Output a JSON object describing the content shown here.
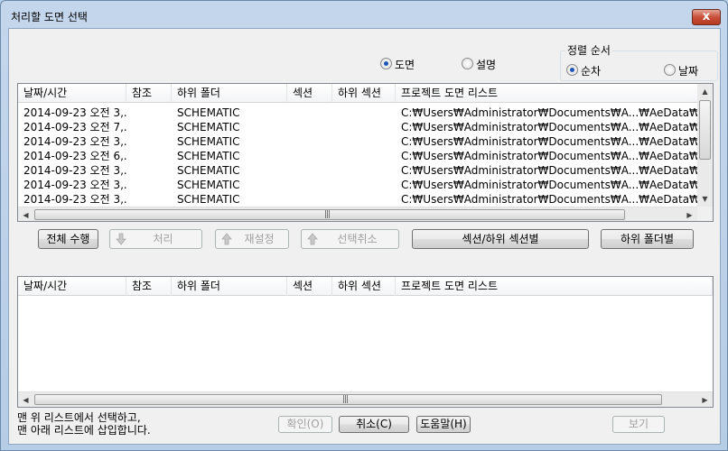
{
  "window": {
    "title": "처리할 도면 선택",
    "close_label": "x"
  },
  "view_mode": {
    "options": [
      {
        "label": "도면",
        "checked": true
      },
      {
        "label": "설명",
        "checked": false
      }
    ]
  },
  "sort": {
    "group_label": "정렬 순서",
    "options": [
      {
        "label": "순차",
        "checked": true
      },
      {
        "label": "날짜",
        "checked": false
      }
    ]
  },
  "columns": [
    "날짜/시간",
    "참조",
    "하위 폴더",
    "섹션",
    "하위 섹션",
    "프로젝트 도면 리스트"
  ],
  "upper_list": {
    "rows": [
      {
        "datetime": "2014-09-23 오전 3,...",
        "ref": "",
        "subfolder": "SCHEMATIC",
        "section": "",
        "subsection": "",
        "path": "C:₩Users₩Administrator₩Documents₩A...₩AeData₩pro"
      },
      {
        "datetime": "2014-09-23 오전 7,...",
        "ref": "",
        "subfolder": "SCHEMATIC",
        "section": "",
        "subsection": "",
        "path": "C:₩Users₩Administrator₩Documents₩A...₩AeData₩pro"
      },
      {
        "datetime": "2014-09-23 오전 3,...",
        "ref": "",
        "subfolder": "SCHEMATIC",
        "section": "",
        "subsection": "",
        "path": "C:₩Users₩Administrator₩Documents₩A...₩AeData₩pro"
      },
      {
        "datetime": "2014-09-23 오전 6,...",
        "ref": "",
        "subfolder": "SCHEMATIC",
        "section": "",
        "subsection": "",
        "path": "C:₩Users₩Administrator₩Documents₩A...₩AeData₩pro"
      },
      {
        "datetime": "2014-09-23 오전 3,...",
        "ref": "",
        "subfolder": "SCHEMATIC",
        "section": "",
        "subsection": "",
        "path": "C:₩Users₩Administrator₩Documents₩A...₩AeData₩pro"
      },
      {
        "datetime": "2014-09-23 오전 3,...",
        "ref": "",
        "subfolder": "SCHEMATIC",
        "section": "",
        "subsection": "",
        "path": "C:₩Users₩Administrator₩Documents₩A...₩AeData₩pro"
      },
      {
        "datetime": "2014-09-23 오전 3,...",
        "ref": "",
        "subfolder": "SCHEMATIC",
        "section": "",
        "subsection": "",
        "path": "C:₩Users₩Administrator₩Documents₩A...₩AeData₩pro"
      }
    ]
  },
  "lower_list": {
    "rows": []
  },
  "middle_buttons": {
    "do_all": "전체 수행",
    "process": "처리",
    "reset": "재설정",
    "deselect": "선택취소",
    "by_section": "섹션/하위 섹션별",
    "by_subfolder": "하위 폴더별"
  },
  "footer": {
    "hint_line1": "맨 위 리스트에서 선택하고,",
    "hint_line2": "맨 아래 리스트에 삽입합니다.",
    "ok": "확인(O)",
    "cancel": "취소(C)",
    "help": "도움말(H)",
    "view": "보기"
  },
  "icons": {
    "close": "close-icon",
    "process": "arrow-down-icon",
    "reset": "arrow-up-icon",
    "deselect": "arrow-up-icon"
  }
}
